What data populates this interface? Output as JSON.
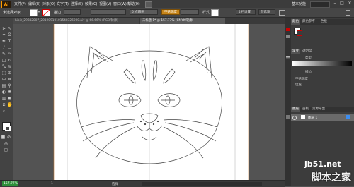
{
  "app": {
    "logo": "Ai"
  },
  "menu": {
    "items": [
      "文件(F)",
      "编辑(E)",
      "对象(O)",
      "文字(T)",
      "选择(S)",
      "效果(C)",
      "视图(V)",
      "窗口(W)",
      "帮助(H)"
    ],
    "workspace": "基本功能",
    "search_placeholder": ""
  },
  "control_bar": {
    "selection_label": "未选择对象",
    "stroke_label": "描边",
    "stroke_style": "5 点圆形",
    "opacity_label": "不透明度",
    "style_label": "样式",
    "doc_settings_label": "文档设置",
    "prefs_label": "首选项"
  },
  "tabs": [
    {
      "label": "hipic_29842007_20190910101548326000.ai* @ 66.66% (RGB/轮廓)",
      "active": false
    },
    {
      "label": "未标题-1* @ 157.77% (CMYK/轮廓)",
      "active": true
    }
  ],
  "status": {
    "zoom": "157.77%",
    "page": "1",
    "tool": "选择"
  },
  "panels": {
    "color_tabs": [
      "颜色",
      "颜色参考",
      "色板"
    ],
    "gradient_tabs": [
      "渐变",
      "透明度"
    ],
    "gradient_type_label": "类型",
    "gradient_stroke_label": "描边",
    "opacity_label": "不透明度",
    "position_label": "位置",
    "layer_tabs": [
      "图层",
      "画板",
      "资源导出"
    ],
    "layer_name": "图层 1"
  },
  "watermark": {
    "domain": "jb51.net",
    "site": "脚本之家"
  },
  "colors": {
    "accent": "#c7851a",
    "layer_highlight": "#3c8df0"
  }
}
